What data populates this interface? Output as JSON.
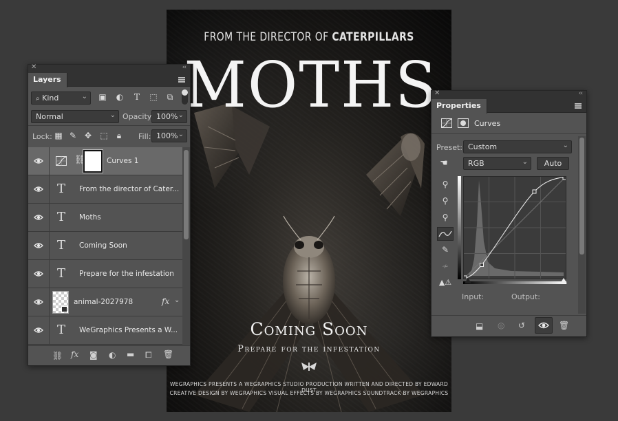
{
  "poster": {
    "top_prefix": "From the director of",
    "top_bold": "CATERPILLARS",
    "title": "MOTHS",
    "coming": "Coming Soon",
    "prepare": "Prepare for the infestation",
    "credits_line1": "WEGRAPHICS PRESENTS A WEGRAPHICS STUDIO PRODUCTION WRITTEN AND DIRECTED BY EDWARD DUST",
    "credits_line2": "CREATIVE DESIGN BY WEGRAPHICS VISUAL EFFECTS BY WEGRAPHICS SOUNDTRACK BY WEGRAPHICS"
  },
  "layers_panel": {
    "tab": "Layers",
    "filter_kind": "Kind",
    "blend_mode": "Normal",
    "opacity_label": "Opacity:",
    "opacity_value": "100%",
    "lock_label": "Lock:",
    "fill_label": "Fill:",
    "fill_value": "100%",
    "layers": [
      {
        "name": "Curves 1",
        "type": "adjustment",
        "selected": true
      },
      {
        "name": "From the director of Cater...",
        "type": "text"
      },
      {
        "name": "Moths",
        "type": "text"
      },
      {
        "name": "Coming Soon",
        "type": "text"
      },
      {
        "name": "Prepare for the infestation",
        "type": "text"
      },
      {
        "name": "animal-2027978",
        "type": "smart-object",
        "fx": "fx"
      },
      {
        "name": "WeGraphics Presents a W...",
        "type": "text"
      }
    ],
    "text_glyph": "T"
  },
  "properties_panel": {
    "tab": "Properties",
    "adjustment": "Curves",
    "preset_label": "Preset:",
    "preset_value": "Custom",
    "channel": "RGB",
    "auto_label": "Auto",
    "input_label": "Input:",
    "output_label": "Output:"
  },
  "curve": {
    "points": [
      [
        0,
        0
      ],
      [
        0.18,
        0.14
      ],
      [
        0.69,
        0.85
      ],
      [
        1,
        1
      ]
    ]
  },
  "colors": {
    "panel_bg": "#535353",
    "panel_dark": "#323232",
    "selected_row": "#696969",
    "app_bg": "#3a3a3a"
  }
}
